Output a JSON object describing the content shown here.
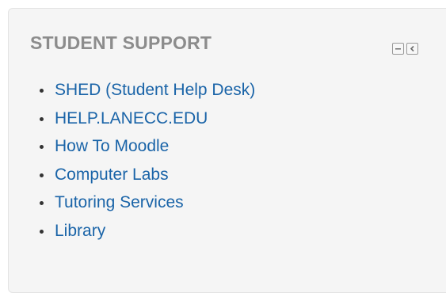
{
  "block": {
    "title": "STUDENT SUPPORT",
    "controls": {
      "minimize_icon": "minus-icon",
      "dock_icon": "chevron-left-icon"
    },
    "links": [
      {
        "label": "SHED (Student Help Desk)"
      },
      {
        "label": "HELP.LANECC.EDU"
      },
      {
        "label": "How To Moodle"
      },
      {
        "label": "Computer Labs"
      },
      {
        "label": "Tutoring Services"
      },
      {
        "label": "Library"
      }
    ]
  },
  "colors": {
    "title": "#8c8c8c",
    "link": "#1a64a8",
    "block_bg": "#f5f5f5"
  }
}
